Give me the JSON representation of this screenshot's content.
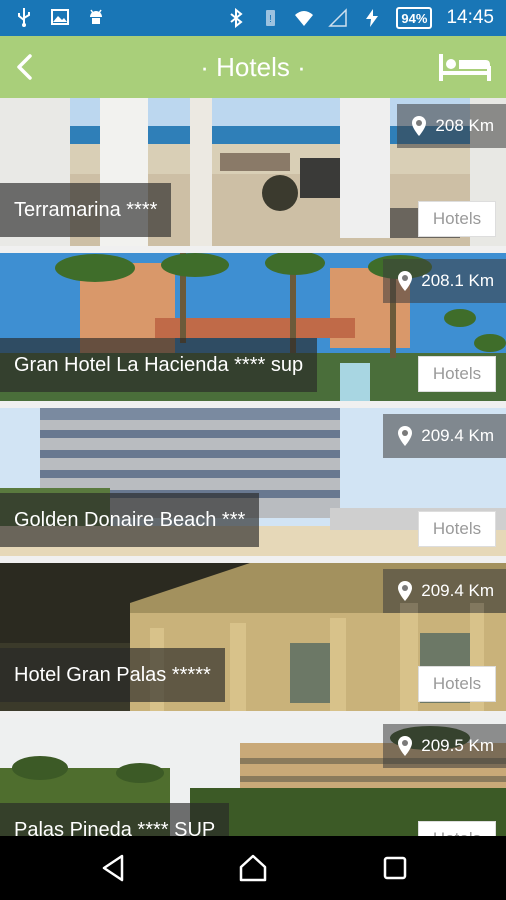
{
  "status_bar": {
    "battery": "94%",
    "time": "14:45"
  },
  "header": {
    "title": "· Hotels ·"
  },
  "hotels": [
    {
      "name": "Terramarina ****",
      "distance": "208 Km",
      "category": "Hotels"
    },
    {
      "name": "Gran Hotel La Hacienda **** sup",
      "distance": "208.1 Km",
      "category": "Hotels"
    },
    {
      "name": "Golden Donaire Beach ***",
      "distance": "209.4 Km",
      "category": "Hotels"
    },
    {
      "name": "Hotel Gran Palas *****",
      "distance": "209.4 Km",
      "category": "Hotels"
    },
    {
      "name": "Palas Pineda **** SUP",
      "distance": "209.5 Km",
      "category": "Hotels"
    }
  ],
  "colors": {
    "status_bar": "#1976b6",
    "app_bar": "#a9cf7a"
  }
}
